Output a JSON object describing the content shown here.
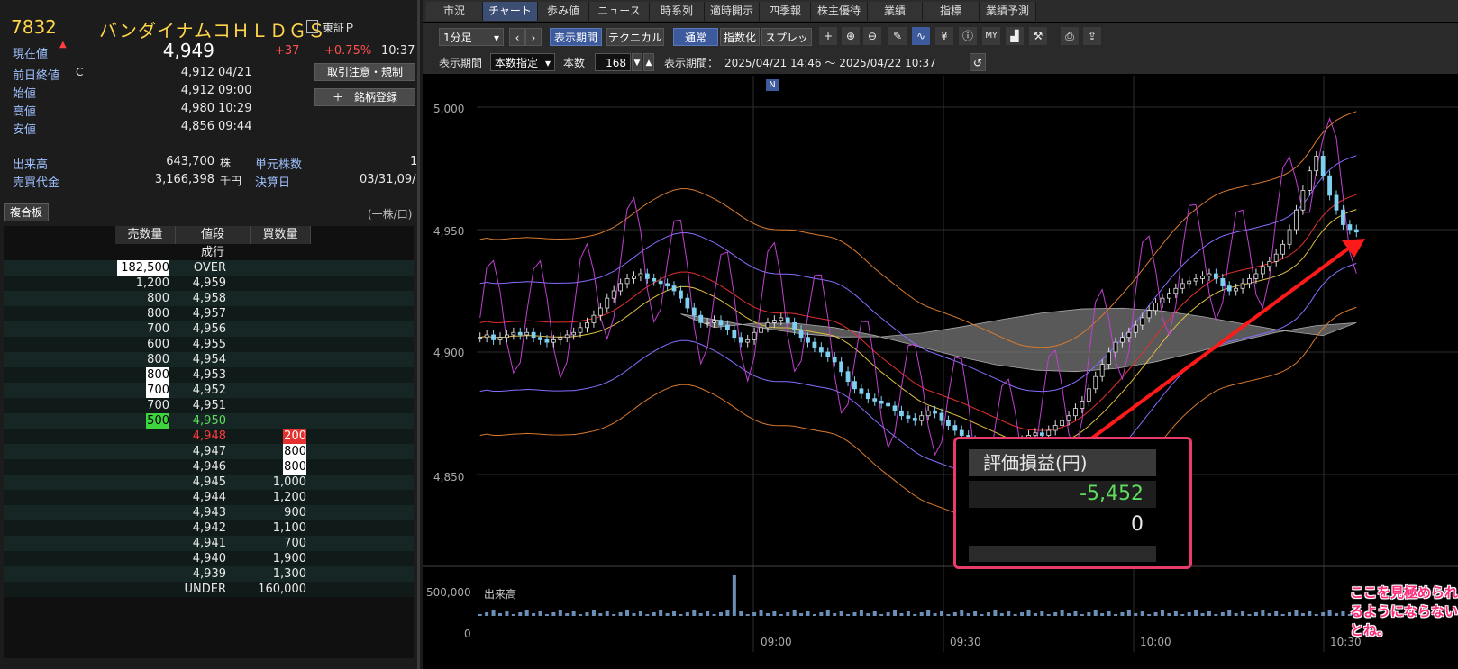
{
  "stock": {
    "code": "7832",
    "name": "バンダイナムコＨＬＤＧＳ",
    "market": "東証Ｐ",
    "current_label": "現在値",
    "current_value": "4,949",
    "change": "+37",
    "change_pct": "+0.75%",
    "time": "10:37",
    "prev_close_label": "前日終値",
    "prev_close_mark": "C",
    "prev_close": "4,912",
    "prev_close_date": "04/21",
    "open_label": "始値",
    "open": "4,912",
    "open_time": "09:00",
    "high_label": "高値",
    "high": "4,980",
    "high_time": "10:29",
    "low_label": "安値",
    "low": "4,856",
    "low_time": "09:44",
    "volume_label": "出来高",
    "volume": "643,700",
    "volume_unit": "株",
    "turnover_label": "売買代金",
    "turnover": "3,166,398",
    "turnover_unit": "千円",
    "lot_label": "単元株数",
    "lot_value": "1",
    "settle_label": "決算日",
    "settle_value": "03/31,09/",
    "btn_caution": "取引注意・規制",
    "btn_register": "＋　銘柄登録"
  },
  "book": {
    "tab_label": "複合板",
    "unit_note": "(一株/口)",
    "headers": [
      "売数量",
      "値段",
      "買数量"
    ],
    "market_order": "成行",
    "rows": [
      {
        "sell": "182,500",
        "price": "OVER",
        "buy": "",
        "sell_hl": "white"
      },
      {
        "sell": "1,200",
        "price": "4,959",
        "buy": ""
      },
      {
        "sell": "800",
        "price": "4,958",
        "buy": ""
      },
      {
        "sell": "800",
        "price": "4,957",
        "buy": ""
      },
      {
        "sell": "700",
        "price": "4,956",
        "buy": ""
      },
      {
        "sell": "600",
        "price": "4,955",
        "buy": ""
      },
      {
        "sell": "800",
        "price": "4,954",
        "buy": ""
      },
      {
        "sell": "800",
        "price": "4,953",
        "buy": "",
        "sell_hl": "white"
      },
      {
        "sell": "700",
        "price": "4,952",
        "buy": "",
        "sell_hl": "white"
      },
      {
        "sell": "700",
        "price": "4,951",
        "buy": ""
      },
      {
        "sell": "500",
        "price": "4,950",
        "buy": "",
        "sell_hl": "green",
        "price_color": "green"
      },
      {
        "sell": "",
        "price": "4,948",
        "buy": "200",
        "buy_hl": "red",
        "price_color": "red"
      },
      {
        "sell": "",
        "price": "4,947",
        "buy": "800",
        "buy_hl": "white"
      },
      {
        "sell": "",
        "price": "4,946",
        "buy": "800",
        "buy_hl": "white"
      },
      {
        "sell": "",
        "price": "4,945",
        "buy": "1,000"
      },
      {
        "sell": "",
        "price": "4,944",
        "buy": "1,200"
      },
      {
        "sell": "",
        "price": "4,943",
        "buy": "900"
      },
      {
        "sell": "",
        "price": "4,942",
        "buy": "1,100"
      },
      {
        "sell": "",
        "price": "4,941",
        "buy": "700"
      },
      {
        "sell": "",
        "price": "4,940",
        "buy": "1,900"
      },
      {
        "sell": "",
        "price": "4,939",
        "buy": "1,300"
      },
      {
        "sell": "",
        "price": "UNDER",
        "buy": "160,000"
      }
    ]
  },
  "tabs": [
    "市況",
    "チャート",
    "歩み値",
    "ニュース",
    "時系列",
    "適時開示",
    "四季報",
    "株主優待",
    "業績",
    "指標",
    "業績予測"
  ],
  "active_tab": 1,
  "toolbar": {
    "interval": "1分足",
    "display_period": "表示期間",
    "technical": "テクニカル",
    "normal": "通常",
    "index": "指数化",
    "spread": "スプレッド",
    "period_label": "表示期間",
    "period_mode": "本数指定",
    "count_label": "本数",
    "count": "168",
    "range_label": "表示期間：",
    "range": "2025/04/21 14:46 〜 2025/04/22 10:37"
  },
  "pl_box": {
    "title": "評価損益(円)",
    "value": "-5,452",
    "value2": "0"
  },
  "annotation": "ここを見極められるようにならないとね。",
  "volume_label": "出来高",
  "colors": {
    "up": "#e8e8e8",
    "down": "#7fd0f0",
    "accent": "#3c5a9c",
    "red": "#ff1a1a"
  },
  "chart_data": {
    "type": "candlestick",
    "y_ticks": [
      "5,000",
      "4,950",
      "4,900",
      "4,850"
    ],
    "ylim": [
      4810,
      5005
    ],
    "x_ticks": [
      "09:00",
      "09:30",
      "10:00",
      "10:30"
    ],
    "volume_ticks": [
      "500,000",
      "0"
    ],
    "marker": "N",
    "close": [
      4906,
      4907,
      4905,
      4906,
      4907,
      4908,
      4907,
      4908,
      4906,
      4905,
      4904,
      4905,
      4906,
      4907,
      4908,
      4910,
      4912,
      4915,
      4918,
      4922,
      4925,
      4928,
      4930,
      4931,
      4932,
      4930,
      4929,
      4928,
      4927,
      4925,
      4922,
      4918,
      4915,
      4912,
      4912,
      4913,
      4911,
      4909,
      4906,
      4904,
      4905,
      4908,
      4910,
      4912,
      4913,
      4914,
      4912,
      4909,
      4906,
      4904,
      4902,
      4900,
      4898,
      4896,
      4892,
      4888,
      4885,
      4883,
      4881,
      4880,
      4879,
      4878,
      4876,
      4874,
      4873,
      4872,
      4874,
      4876,
      4875,
      4872,
      4870,
      4868,
      4866,
      4864,
      4862,
      4860,
      4858,
      4857,
      4856,
      4858,
      4861,
      4864,
      4866,
      4867,
      4866,
      4868,
      4870,
      4872,
      4874,
      4877,
      4880,
      4885,
      4890,
      4895,
      4900,
      4904,
      4906,
      4908,
      4911,
      4914,
      4917,
      4920,
      4922,
      4924,
      4926,
      4928,
      4929,
      4930,
      4931,
      4932,
      4930,
      4927,
      4925,
      4926,
      4928,
      4930,
      4932,
      4935,
      4937,
      4940,
      4944,
      4950,
      4958,
      4966,
      4974,
      4980,
      4972,
      4964,
      4958,
      4952,
      4950,
      4949
    ]
  }
}
